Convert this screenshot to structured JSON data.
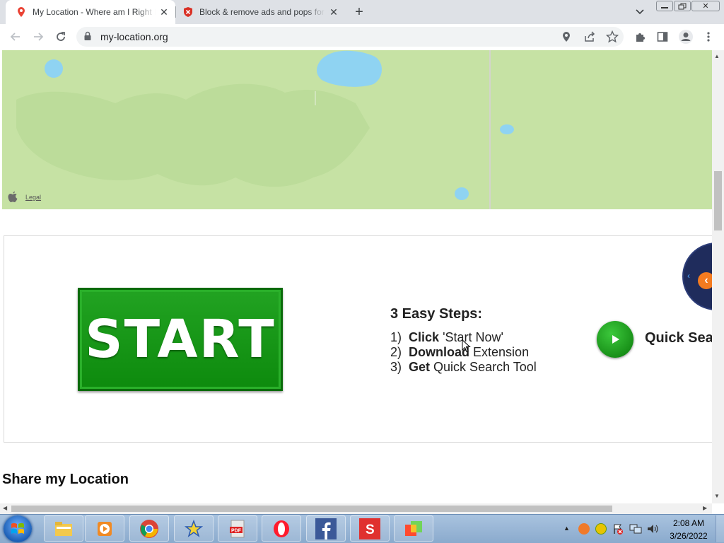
{
  "tabs": [
    {
      "title": "My Location - Where am I Right Now",
      "active": true,
      "icon": "map-pin-icon"
    },
    {
      "title": "Block & remove ads and pops for free",
      "active": false,
      "icon": "shield-x-icon"
    }
  ],
  "toolbar": {
    "url": "my-location.org"
  },
  "map": {
    "legal_label": "Legal"
  },
  "ad": {
    "start_label": "START",
    "steps_title": "3 Easy Steps:",
    "steps": [
      {
        "num": "1)",
        "bold": "Click",
        "rest": " 'Start Now'"
      },
      {
        "num": "2)",
        "bold": "Download",
        "rest": " Extension"
      },
      {
        "num": "3)",
        "bold": "Get",
        "rest": " Quick Search Tool"
      }
    ],
    "quick_search_label": "Quick Search"
  },
  "share": {
    "title": "Share my Location"
  },
  "taskbar": {
    "apps": [
      "windows-explorer-icon",
      "media-player-icon",
      "chrome-icon",
      "star-app-icon",
      "pdf-icon",
      "opera-icon",
      "facebook-icon",
      "s-app-icon",
      "colorful-app-icon"
    ],
    "time": "2:08 AM",
    "date": "3/26/2022"
  },
  "colors": {
    "tabstrip": "#dee1e6",
    "map_land": "#c6e2a4",
    "map_water": "#8fd3f2",
    "start_green": "#129612",
    "taskbar": "#9bb8d9"
  }
}
